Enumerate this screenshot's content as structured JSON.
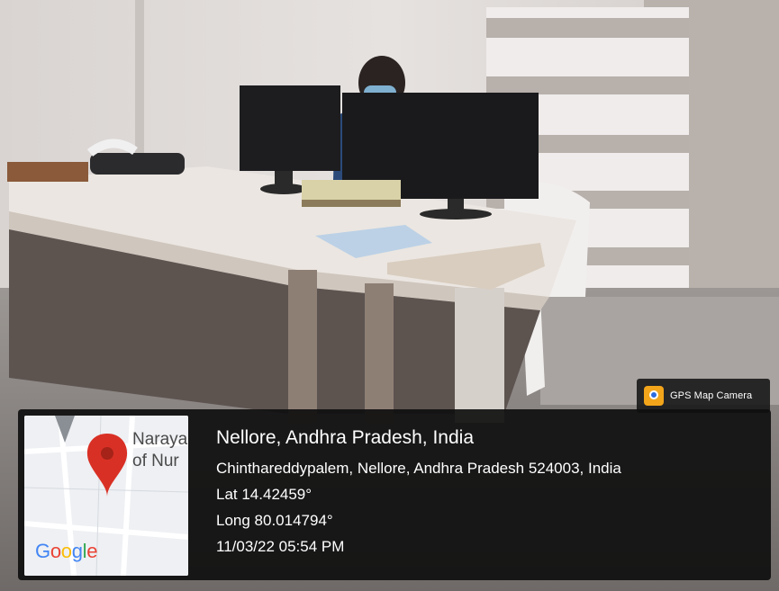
{
  "gps_badge": {
    "label": "GPS Map Camera",
    "icon": "gps-map-camera-logo-icon"
  },
  "location": {
    "city": "Nellore, Andhra Pradesh, India",
    "address": "Chinthareddypalem, Nellore, Andhra Pradesh 524003, India",
    "lat": "Lat 14.42459°",
    "long": "Long 80.014794°",
    "datetime": "11/03/22 05:54 PM"
  },
  "map": {
    "label_line1": "Naraya",
    "label_line2": "of Nur",
    "pin_icon": "map-pin-icon",
    "google_logo": "Google"
  },
  "colors": {
    "pin": "#d93025",
    "panel": "#0f0f0f",
    "badge_logo": "#f2a51a"
  }
}
